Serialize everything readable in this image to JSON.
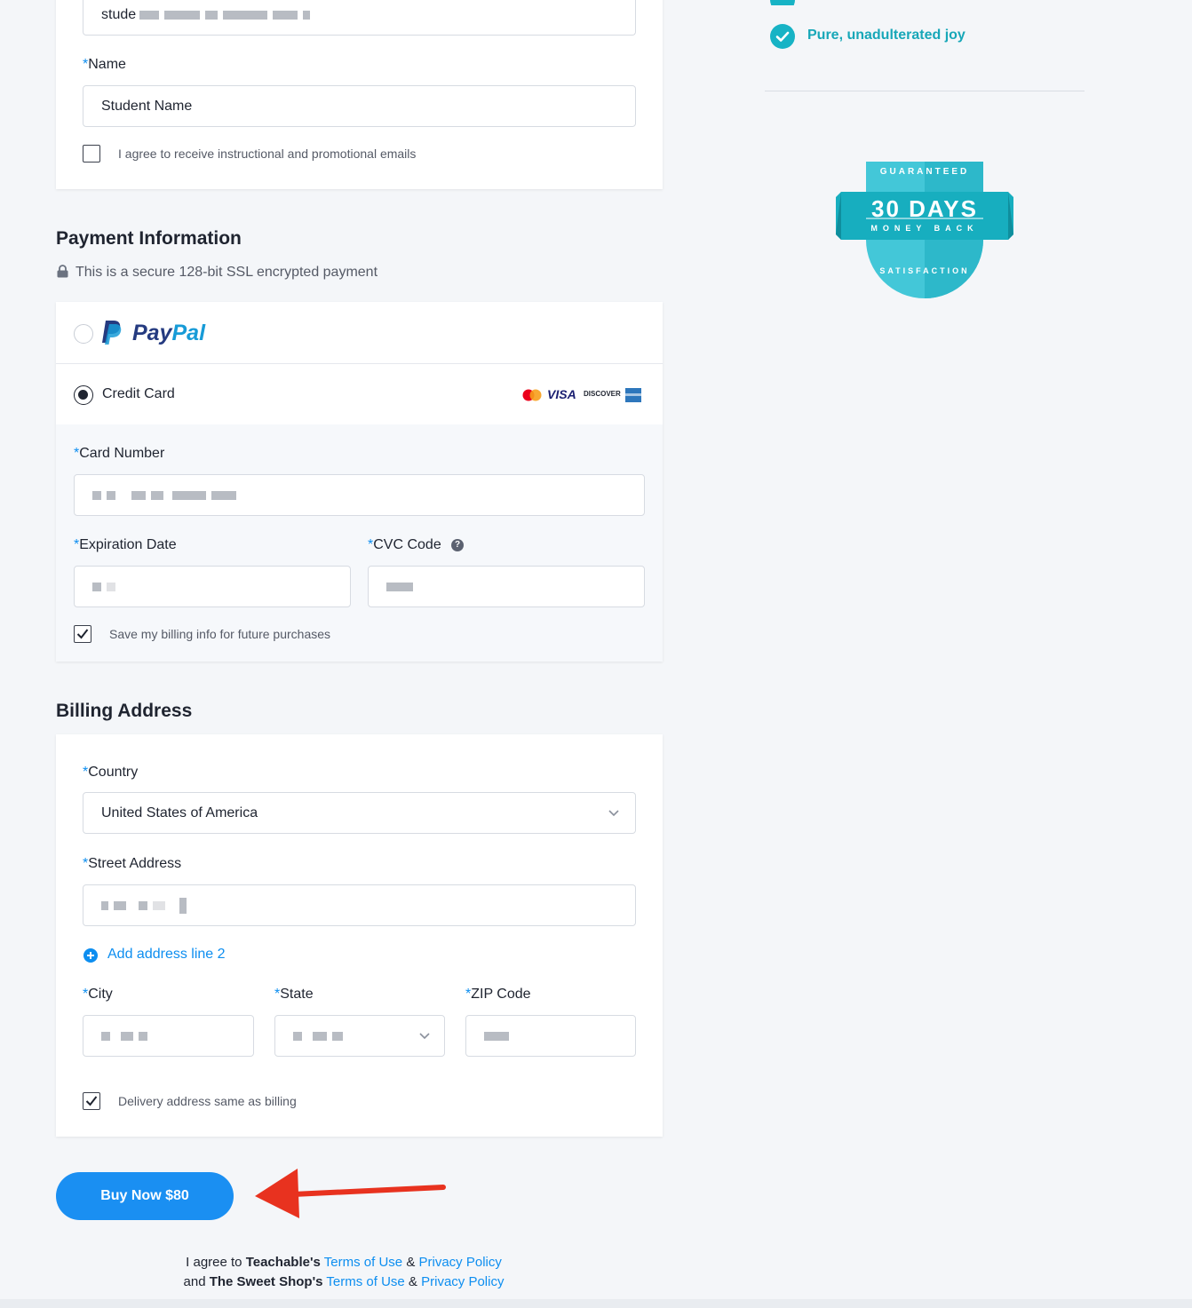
{
  "sidebar": {
    "feature": "Pure, unadulterated joy",
    "badge": {
      "top": "GUARANTEED",
      "main": "30 DAYS",
      "sub": "MONEY BACK",
      "bottom": "SATISFACTION"
    }
  },
  "account": {
    "email_value": "stude",
    "name_label": "Name",
    "name_value": "Student Name",
    "emails_checkbox_label": "I agree to receive instructional and promotional emails",
    "emails_checked": false
  },
  "payment": {
    "title": "Payment Information",
    "secure_note": "This is a secure 128-bit SSL encrypted payment",
    "paypal_pay": "Pay",
    "paypal_pal": "Pal",
    "credit_card_label": "Credit Card",
    "brands": [
      "VISA",
      "DISCOVER"
    ],
    "card_number_label": "Card Number",
    "expiration_label": "Expiration Date",
    "cvc_label": "CVC Code",
    "save_billing_label": "Save my billing info for future purchases",
    "save_billing_checked": true,
    "selected_method": "credit-card"
  },
  "billing": {
    "title": "Billing Address",
    "country_label": "Country",
    "country_value": "United States of America",
    "street_label": "Street Address",
    "add_line2": "Add address line 2",
    "city_label": "City",
    "state_label": "State",
    "zip_label": "ZIP Code",
    "delivery_same_label": "Delivery address same as billing",
    "delivery_same_checked": true
  },
  "cta": {
    "buy_label": "Buy Now $80"
  },
  "legal": {
    "line1_prefix": "I agree to",
    "line1_company": "Teachable's",
    "line1_terms": "Terms of Use",
    "line1_amp": "&",
    "line1_privacy": "Privacy Policy",
    "line2_prefix": "and",
    "line2_company": "The Sweet Shop's",
    "line2_terms": "Terms of Use",
    "line2_amp": "&",
    "line2_privacy": "Privacy Policy"
  },
  "colors": {
    "accent": "#0d8ef0",
    "teal": "#17b3c5",
    "cta": "#1a8ff2",
    "arrow": "#e8321f"
  }
}
